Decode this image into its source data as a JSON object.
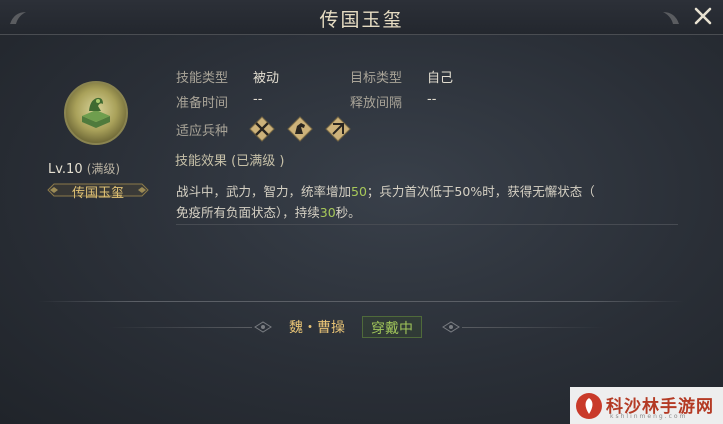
{
  "window": {
    "title": "传国玉玺"
  },
  "item": {
    "level": "Lv.10",
    "level_note": "(满级)",
    "name": "传国玉玺",
    "icon": "jade-seal-icon"
  },
  "attributes": [
    {
      "label": "技能类型",
      "value": "被动"
    },
    {
      "label": "目标类型",
      "value": "自己"
    },
    {
      "label": "准备时间",
      "value": "--"
    },
    {
      "label": "释放间隔",
      "value": "--"
    }
  ],
  "troops": {
    "label": "适应兵种",
    "icons": [
      "infantry-icon",
      "cavalry-icon",
      "archer-icon"
    ]
  },
  "effect": {
    "label": "技能效果 (已满级 )",
    "desc_1": "战斗中，武力，智力，统率增加",
    "stat_value": "50",
    "desc_2": "；兵力首次低于50%时，获得无懈状态（",
    "desc_3": "免疫所有负面状态），持续",
    "duration": "30",
    "desc_4": "秒。"
  },
  "footer": {
    "owner": "魏・曹操",
    "status": "穿戴中"
  },
  "watermark": {
    "name": "科沙林手游网",
    "sub": "kshlinmeng.com"
  },
  "colors": {
    "highlight": "#a8c95a",
    "gold": "#e0c275",
    "equip_green": "#9fc45a",
    "background": "#2e333b"
  }
}
